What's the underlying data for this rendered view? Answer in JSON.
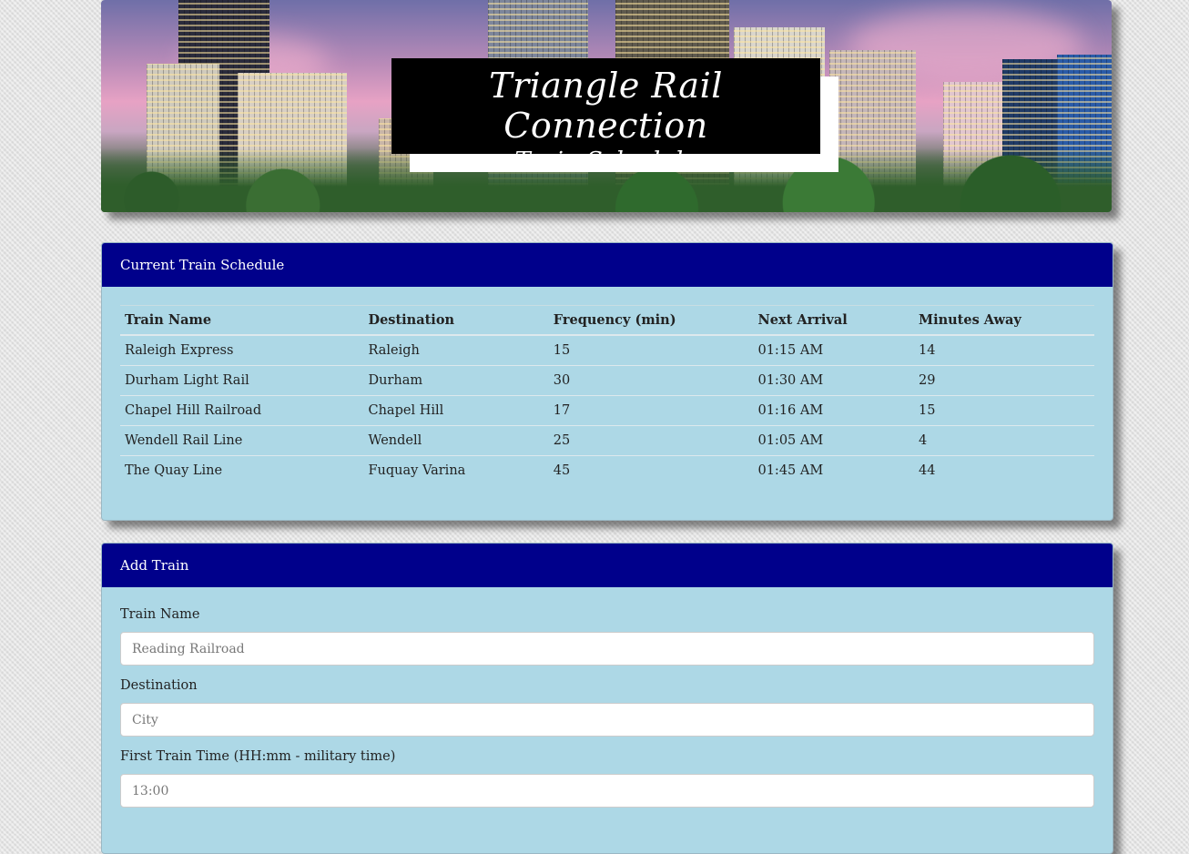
{
  "header": {
    "title": "Triangle Rail Connection",
    "subtitle": "Train Schedule"
  },
  "schedule": {
    "heading": "Current Train Schedule",
    "columns": [
      "Train Name",
      "Destination",
      "Frequency (min)",
      "Next Arrival",
      "Minutes Away"
    ],
    "rows": [
      [
        "Raleigh Express",
        "Raleigh",
        "15",
        "01:15 AM",
        "14"
      ],
      [
        "Durham Light Rail",
        "Durham",
        "30",
        "01:30 AM",
        "29"
      ],
      [
        "Chapel Hill Railroad",
        "Chapel Hill",
        "17",
        "01:16 AM",
        "15"
      ],
      [
        "Wendell Rail Line",
        "Wendell",
        "25",
        "01:05 AM",
        "4"
      ],
      [
        "The Quay Line",
        "Fuquay Varina",
        "45",
        "01:45 AM",
        "44"
      ]
    ]
  },
  "add_train": {
    "heading": "Add Train",
    "fields": [
      {
        "label": "Train Name",
        "placeholder": "Reading Railroad",
        "value": ""
      },
      {
        "label": "Destination",
        "placeholder": "City",
        "value": ""
      },
      {
        "label": "First Train Time (HH:mm - military time)",
        "placeholder": "13:00",
        "value": ""
      }
    ]
  },
  "colors": {
    "panel_heading_bg": "#00008b",
    "panel_body_bg": "#add8e6",
    "title_box_bg": "#000000"
  }
}
